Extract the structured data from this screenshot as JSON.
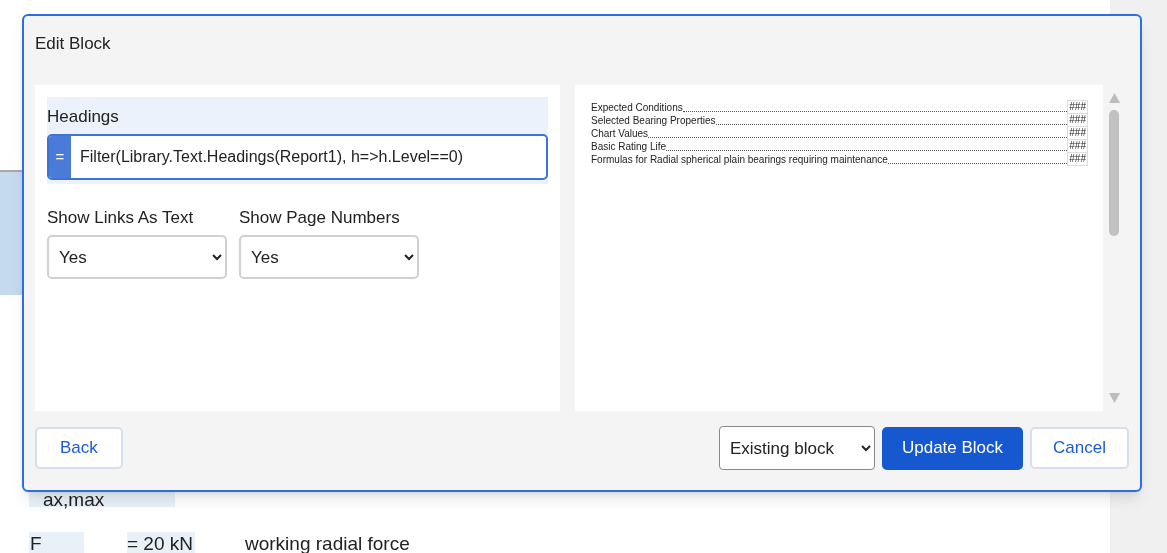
{
  "background": {
    "formula_fragment": "ax,max",
    "symbol": "F",
    "value": "= 20 kN",
    "description": "working radial force"
  },
  "dialog": {
    "title": "Edit Block"
  },
  "heading_field": {
    "label": "Headings",
    "prefix": "=",
    "value": "Filter(Library.Text.Headings(Report1), h=>h.Level==0)"
  },
  "options": [
    {
      "label": "Show Links As Text",
      "value": "Yes"
    },
    {
      "label": "Show Page Numbers",
      "value": "Yes"
    }
  ],
  "preview": {
    "entries": [
      {
        "title": "Expected Conditions",
        "page": "###"
      },
      {
        "title": "Selected Bearing Properties",
        "page": "###"
      },
      {
        "title": "Chart Values",
        "page": "###"
      },
      {
        "title": "Basic Rating Life",
        "page": "###"
      },
      {
        "title": "Formulas for Radial spherical plain bearings requiring maintenance",
        "page": "###"
      }
    ]
  },
  "footer": {
    "back": "Back",
    "mode": "Existing block",
    "update": "Update Block",
    "cancel": "Cancel"
  }
}
